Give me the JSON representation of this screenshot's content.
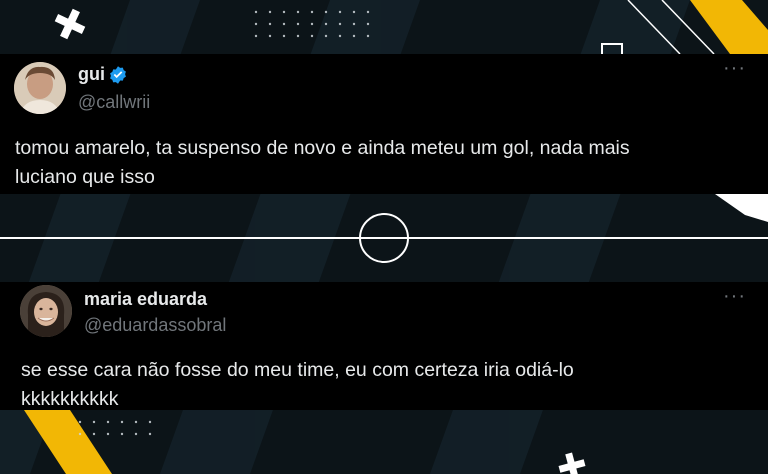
{
  "colors": {
    "background": "#0c1418",
    "card": "#000000",
    "accent_yellow": "#f2b705",
    "text": "#e7e9ea",
    "muted": "#71767b",
    "verified": "#1d9bf0"
  },
  "tweets": [
    {
      "name": "gui",
      "handle": "@callwrii",
      "verified": true,
      "text_lines": [
        "tomou amarelo, ta suspenso de novo e ainda meteu um gol, nada mais",
        "luciano que isso"
      ],
      "more_icon": "ellipsis-icon"
    },
    {
      "name": "maria eduarda",
      "handle": "@eduardassobral",
      "verified": false,
      "text_lines": [
        "se esse cara não fosse do meu time, eu com certeza iria odiá-lo",
        "kkkkkkkkkk"
      ],
      "more_icon": "ellipsis-icon"
    }
  ],
  "more_label": "···"
}
